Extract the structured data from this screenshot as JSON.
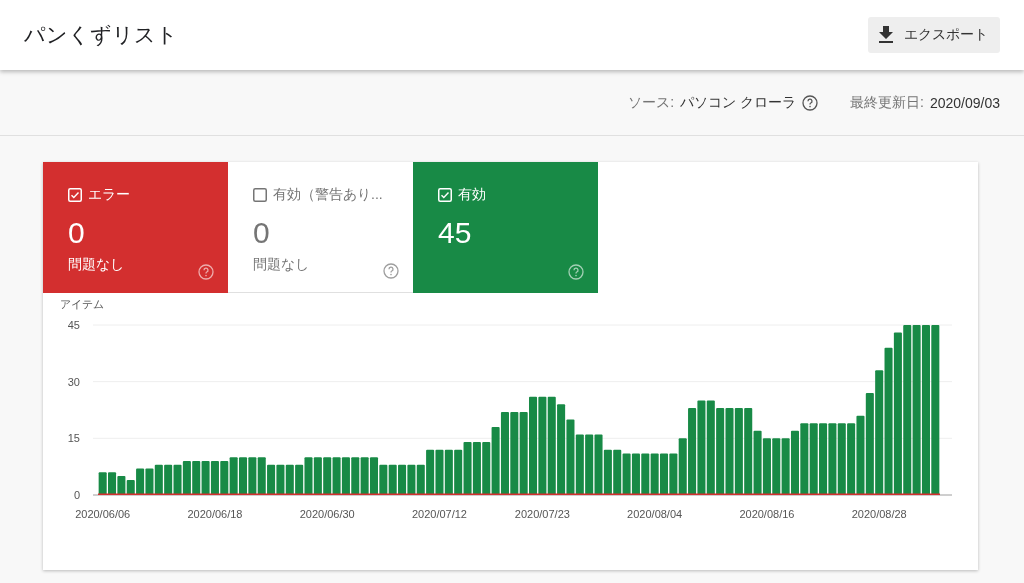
{
  "header": {
    "title": "パンくずリスト",
    "export_button": "エクスポート"
  },
  "info_bar": {
    "source_label": "ソース:",
    "source_value": "パソコン クローラ",
    "updated_label": "最終更新日:",
    "updated_value": "2020/09/03"
  },
  "tiles": [
    {
      "label": "エラー",
      "checked": true,
      "count": "0",
      "caption": "問題なし",
      "color": "#d32f2f"
    },
    {
      "label": "有効（警告あり...",
      "checked": false,
      "count": "0",
      "caption": "問題なし"
    },
    {
      "label": "有効",
      "checked": true,
      "count": "45",
      "color": "#188a46"
    }
  ],
  "chart": {
    "chart_data": {
      "type": "bar",
      "ylabel": "アイテム",
      "ylim": [
        0,
        45
      ],
      "yticks": [
        0,
        15,
        30,
        45
      ],
      "categories": [
        "2020/06/06",
        null,
        null,
        null,
        null,
        null,
        null,
        null,
        null,
        null,
        null,
        null,
        "2020/06/18",
        null,
        null,
        null,
        null,
        null,
        null,
        null,
        null,
        null,
        null,
        null,
        "2020/06/30",
        null,
        null,
        null,
        null,
        null,
        null,
        null,
        null,
        null,
        null,
        null,
        "2020/07/12",
        null,
        null,
        null,
        null,
        null,
        null,
        null,
        null,
        null,
        null,
        "2020/07/23",
        null,
        null,
        null,
        null,
        null,
        null,
        null,
        null,
        null,
        null,
        null,
        "2020/08/04",
        null,
        null,
        null,
        null,
        null,
        null,
        null,
        null,
        null,
        null,
        null,
        "2020/08/16",
        null,
        null,
        null,
        null,
        null,
        null,
        null,
        null,
        null,
        null,
        null,
        "2020/08/28",
        null,
        null,
        null,
        null,
        null,
        null
      ],
      "series": [
        {
          "color": "#188a46",
          "values": [
            6,
            6,
            5,
            4,
            7,
            7,
            8,
            8,
            8,
            9,
            9,
            9,
            9,
            9,
            10,
            10,
            10,
            10,
            8,
            8,
            8,
            8,
            10,
            10,
            10,
            10,
            10,
            10,
            10,
            10,
            8,
            8,
            8,
            8,
            8,
            12,
            12,
            12,
            12,
            14,
            14,
            14,
            18,
            22,
            22,
            22,
            26,
            26,
            26,
            24,
            20,
            16,
            16,
            16,
            12,
            12,
            11,
            11,
            11,
            11,
            11,
            11,
            15,
            23,
            25,
            25,
            23,
            23,
            23,
            23,
            17,
            15,
            15,
            15,
            17,
            19,
            19,
            19,
            19,
            19,
            19,
            21,
            27,
            33,
            39,
            43,
            45,
            45,
            45,
            45
          ]
        },
        {
          "color": "#d32f2f",
          "values": [
            0,
            0,
            0,
            0,
            0,
            0,
            0,
            0,
            0,
            0,
            0,
            0,
            0,
            0,
            0,
            0,
            0,
            0,
            0,
            0,
            0,
            0,
            0,
            0,
            0,
            0,
            0,
            0,
            0,
            0,
            0,
            0,
            0,
            0,
            0,
            0,
            0,
            0,
            0,
            0,
            0,
            0,
            0,
            0,
            0,
            0,
            0,
            0,
            0,
            0,
            0,
            0,
            0,
            0,
            0,
            0,
            0,
            0,
            0,
            0,
            0,
            0,
            0,
            0,
            0,
            0,
            0,
            0,
            0,
            0,
            0,
            0,
            0,
            0,
            0,
            0,
            0,
            0,
            0,
            0,
            0,
            0,
            0,
            0,
            0,
            0,
            0,
            0,
            0,
            0
          ]
        }
      ]
    }
  }
}
